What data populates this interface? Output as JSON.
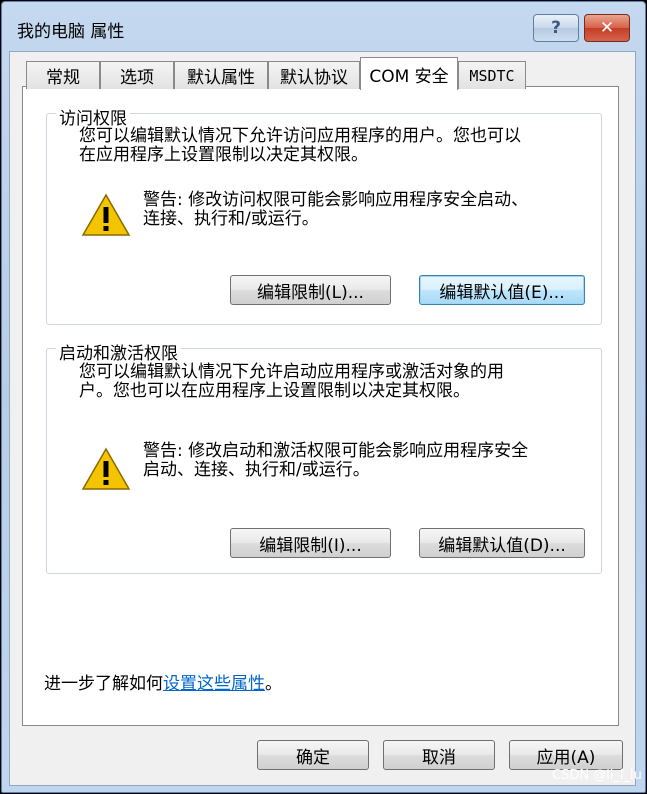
{
  "window": {
    "title": "我的电脑 属性",
    "help_label": "?",
    "close_label": "✕"
  },
  "tabs": [
    {
      "label": "常规"
    },
    {
      "label": "选项"
    },
    {
      "label": "默认属性"
    },
    {
      "label": "默认协议"
    },
    {
      "label": "COM 安全"
    },
    {
      "label": "MSDTC"
    }
  ],
  "access": {
    "group_title": "访问权限",
    "desc_line1": "您可以编辑默认情况下允许访问应用程序的用户。您也可以",
    "desc_line2": "在应用程序上设置限制以决定其权限。",
    "warn_line1": "警告: 修改访问权限可能会影响应用程序安全启动、",
    "warn_line2": "连接、执行和/或运行。",
    "edit_limits_label": "编辑限制(L)...",
    "edit_default_label": "编辑默认值(E)..."
  },
  "launch": {
    "group_title": "启动和激活权限",
    "desc_line1": "您可以编辑默认情况下允许启动应用程序或激活对象的用",
    "desc_line2": "户。您也可以在应用程序上设置限制以决定其权限。",
    "warn_line1": "警告: 修改启动和激活权限可能会影响应用程序安全",
    "warn_line2": "启动、连接、执行和/或运行。",
    "edit_limits_label": "编辑限制(I)...",
    "edit_default_label": "编辑默认值(D)..."
  },
  "footer": {
    "learn_prefix": "进一步了解如何",
    "learn_link": "设置这些属性",
    "learn_suffix": "。",
    "ok_label": "确定",
    "cancel_label": "取消",
    "apply_label": "应用(A)"
  },
  "watermark": "CSDN @li_l_lu",
  "colors": {
    "link": "#0066cc",
    "warning_yellow": "#f5c400",
    "close_red": "#c43d26"
  }
}
